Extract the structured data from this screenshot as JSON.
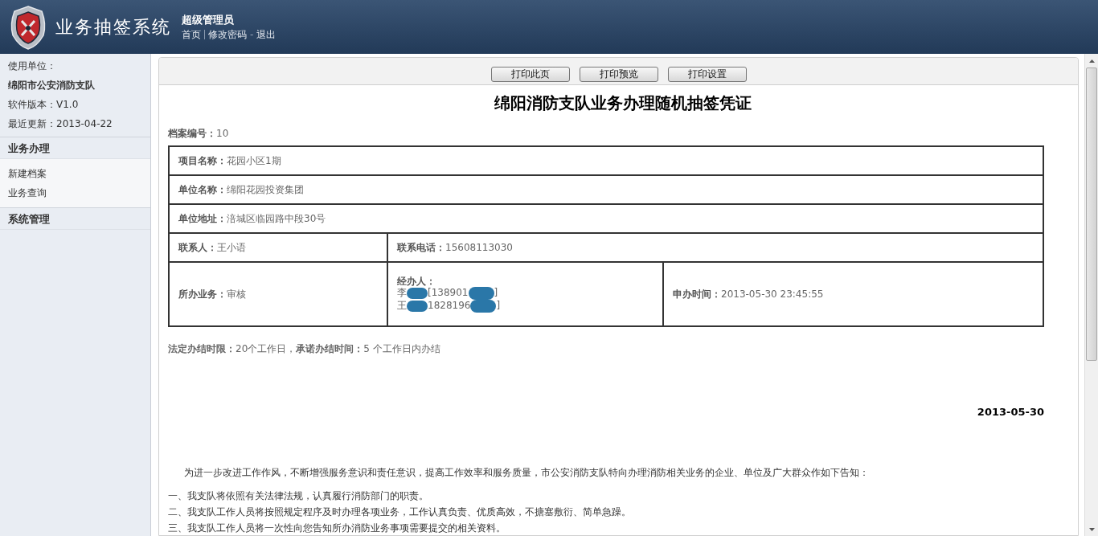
{
  "header": {
    "title": "业务抽签系统",
    "user": "超级管理员",
    "nav": [
      {
        "kind": "link",
        "label": "首页"
      },
      {
        "kind": "rule"
      },
      {
        "kind": "link",
        "label": "修改密码"
      },
      {
        "kind": "text",
        "label": "-"
      },
      {
        "kind": "link",
        "label": "退出"
      }
    ]
  },
  "sidebar": {
    "info": [
      {
        "text": "使用单位：",
        "bold": false
      },
      {
        "text": "绵阳市公安消防支队",
        "bold": true
      },
      {
        "text": "软件版本：V1.0",
        "bold": false
      },
      {
        "text": "最近更新：2013-04-22",
        "bold": false
      }
    ],
    "sections": [
      {
        "title": "业务办理",
        "items": [
          "新建档案",
          "业务查询"
        ]
      },
      {
        "title": "系统管理"
      }
    ]
  },
  "toolbar": {
    "buttons": [
      "打印此页",
      "打印预览",
      "打印设置"
    ]
  },
  "document": {
    "title": "绵阳消防支队业务办理随机抽签凭证",
    "file_no": {
      "label": "档案编号：",
      "value": "10"
    },
    "rows": [
      [
        {
          "label": "项目名称：",
          "value": "花园小区1期"
        }
      ],
      [
        {
          "label": "单位名称：",
          "value": "绵阳花园投资集团"
        }
      ],
      [
        {
          "label": "单位地址：",
          "value": "涪城区临园路中段30号"
        }
      ],
      [
        {
          "label": "联系人：",
          "value": "王小语"
        },
        {
          "label": "联系电话：",
          "value": "15608113030"
        }
      ],
      [
        {
          "label": "所办业务：",
          "value": "审核"
        },
        {
          "label": "经办人：",
          "lines": [
            [
              "李",
              "[138901",
              "]"
            ],
            [
              "王",
              "1828196",
              "]"
            ]
          ]
        },
        {
          "label": "申办时间：",
          "value": "2013-05-30 23:45:55"
        }
      ]
    ],
    "time_limit": "**法定办结时限：**20个工作日，**承诺办结时间：**5 个工作日内办结",
    "date": "2013-05-30",
    "intro": "为进一步改进工作作风，不断增强服务意识和责任意识，提高工作效率和服务质量，市公安消防支队特向办理消防相关业务的企业、单位及广大群众作如下告知：",
    "points": [
      "一、我支队将依照有关法律法规，认真履行消防部门的职责。",
      "二、我支队工作人员将按照规定程序及时办理各项业务，工作认真负责、优质高效，不搪塞敷衍、简单急躁。",
      "三、我支队工作人员将一次性向您告知所办消防业务事项需要提交的相关资料。"
    ]
  }
}
